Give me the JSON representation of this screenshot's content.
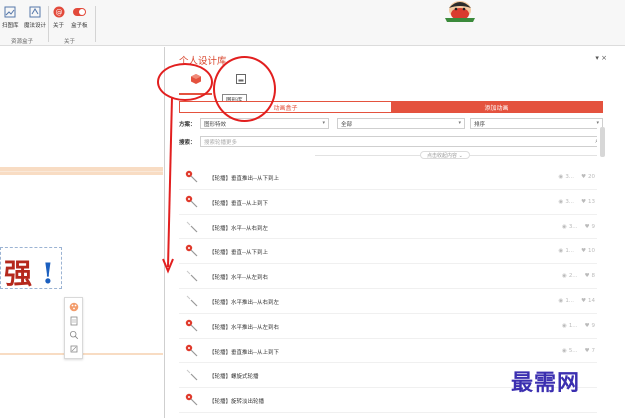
{
  "ribbon": {
    "items": [
      {
        "label": "扫图库",
        "icon": "gallery-icon"
      },
      {
        "label": "魔法设计",
        "icon": "magic-design-icon"
      },
      {
        "label": "关于",
        "icon": "about-icon"
      },
      {
        "label": "盒子板",
        "icon": "box-toggle-icon"
      }
    ],
    "groups": [
      "资源盒子",
      "关于"
    ]
  },
  "slide": {
    "text_main": "强",
    "text_mark": "!"
  },
  "panel": {
    "title": "个人设计库",
    "controls": "▾ ×",
    "tooltip": "图形库",
    "segments": [
      "动画盒子",
      "添加动画"
    ],
    "filters": {
      "scheme_label": "方案：",
      "scheme_value": "图形特效",
      "category_value": "全部",
      "sort_value": "排序"
    },
    "search": {
      "label": "搜索：",
      "placeholder": "搜索轮播更多"
    },
    "collapse_label": "点击收起内容 ⌄",
    "items": [
      {
        "label": "【轮播】垂直推出--从下到上",
        "views": "3...",
        "likes": "20",
        "type": "red"
      },
      {
        "label": "【轮播】垂直--从上到下",
        "views": "3...",
        "likes": "13",
        "type": "red"
      },
      {
        "label": "【轮播】水平--从右到左",
        "views": "3...",
        "likes": "9",
        "type": "gray"
      },
      {
        "label": "【轮播】垂直--从下到上",
        "views": "1...",
        "likes": "10",
        "type": "red"
      },
      {
        "label": "【轮播】水平--从左到右",
        "views": "2...",
        "likes": "8",
        "type": "gray"
      },
      {
        "label": "【轮播】水平推出--从右到左",
        "views": "1...",
        "likes": "14",
        "type": "gray"
      },
      {
        "label": "【轮播】水平推出--从左到右",
        "views": "1...",
        "likes": "9",
        "type": "red"
      },
      {
        "label": "【轮播】垂直推出--从上到下",
        "views": "5...",
        "likes": "7",
        "type": "red"
      },
      {
        "label": "【轮播】螺旋式轮播",
        "views": "",
        "likes": "",
        "type": "gray"
      },
      {
        "label": "【轮播】旋转淡出轮播",
        "views": "",
        "likes": "",
        "type": "red"
      }
    ]
  },
  "watermark": "最需网",
  "colors": {
    "accent": "#e4523e",
    "annotation": "#e21f1f",
    "slide_bg": "#f8dcc3"
  }
}
